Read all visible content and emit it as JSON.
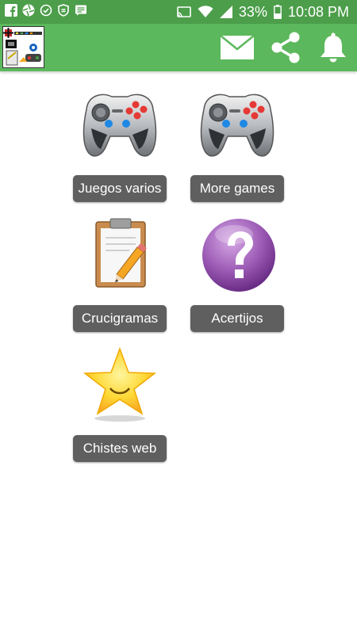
{
  "status_bar": {
    "battery": "33%",
    "time": "10:08 PM",
    "icons": [
      "facebook-icon",
      "aperture-icon",
      "check-circle-icon",
      "shield-icon",
      "message-icon",
      "cast-icon",
      "wifi-icon",
      "signal-icon",
      "battery-icon"
    ]
  },
  "app_bar": {
    "colors": {
      "bar": "#5cb85c",
      "status": "#4c9e4a"
    },
    "actions": [
      "mail-icon",
      "share-icon",
      "bell-icon"
    ]
  },
  "menu": {
    "items": [
      {
        "label": "Juegos varios",
        "icon": "gamepad-icon"
      },
      {
        "label": "More games",
        "icon": "gamepad-icon"
      },
      {
        "label": "Crucigramas",
        "icon": "clipboard-pencil-icon"
      },
      {
        "label": "Acertijos",
        "icon": "question-icon"
      },
      {
        "label": "Chistes web",
        "icon": "star-icon"
      }
    ],
    "button_color": "#5f5f5f"
  }
}
